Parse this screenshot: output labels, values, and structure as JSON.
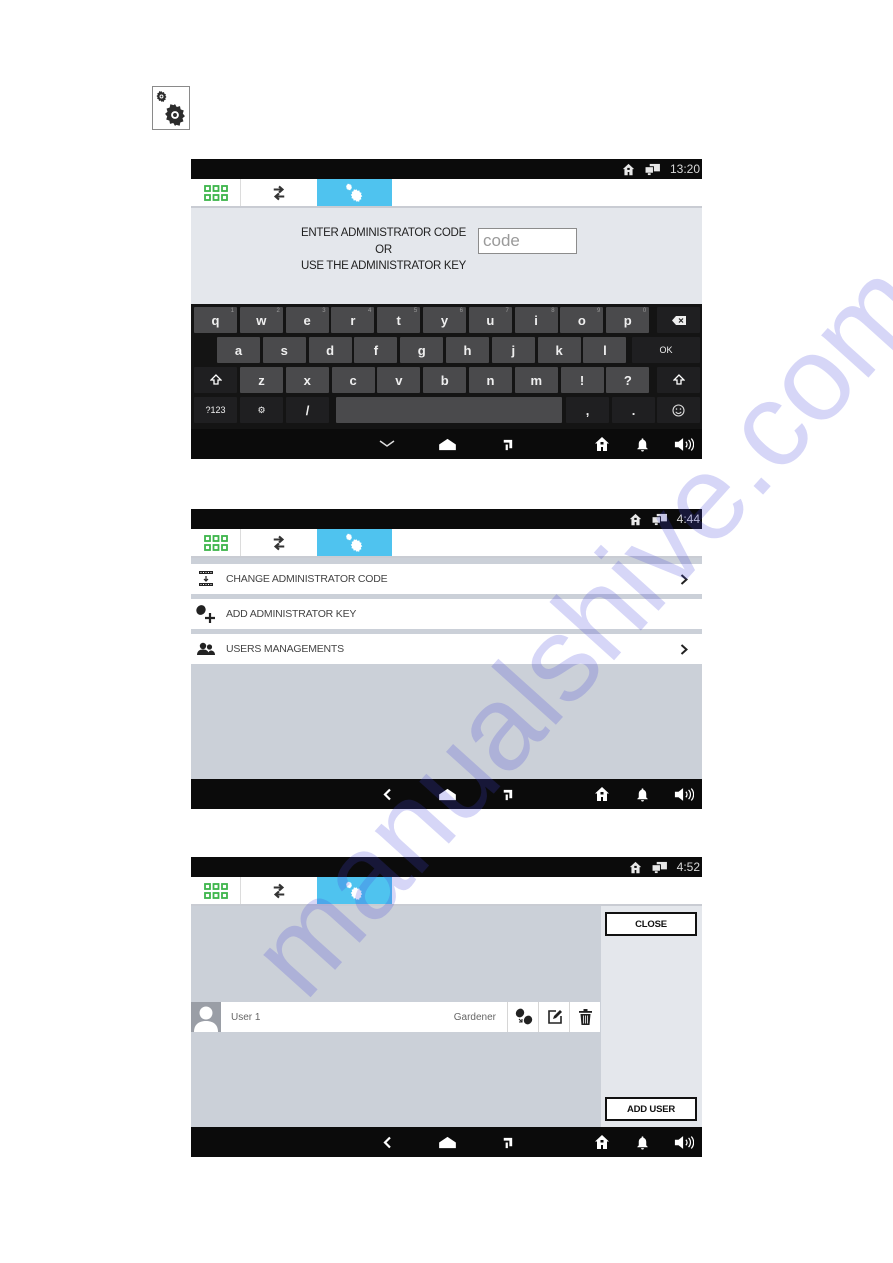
{
  "page": {
    "header_icon": "settings-gears-icon",
    "watermark": "manualshive.com"
  },
  "colors": {
    "tab_active": "#4fc3ef",
    "apps_icon": "#3cb54a",
    "status_bar": "#0b0b0b",
    "content_bg": "#cbd0d8"
  },
  "screens": [
    {
      "status": {
        "clock": "13:20",
        "icons": [
          "home-icon",
          "network-icon"
        ]
      },
      "tabs": [
        {
          "name": "apps",
          "icon": "grid-icon",
          "active": false
        },
        {
          "name": "transfer",
          "icon": "transfer-arrows-icon",
          "active": false
        },
        {
          "name": "settings",
          "icon": "settings-gears-icon",
          "active": true
        }
      ],
      "prompt": {
        "line1": "ENTER ADMINISTRATOR CODE",
        "line2": "OR",
        "line3": "USE THE ADMINISTRATOR KEY"
      },
      "code_input": {
        "placeholder": "code",
        "value": ""
      },
      "keyboard": {
        "row1": [
          {
            "k": "q",
            "h": "1"
          },
          {
            "k": "w",
            "h": "2"
          },
          {
            "k": "e",
            "h": "3"
          },
          {
            "k": "r",
            "h": "4"
          },
          {
            "k": "t",
            "h": "5"
          },
          {
            "k": "y",
            "h": "6"
          },
          {
            "k": "u",
            "h": "7"
          },
          {
            "k": "i",
            "h": "8"
          },
          {
            "k": "o",
            "h": "9"
          },
          {
            "k": "p",
            "h": "0"
          }
        ],
        "row2": [
          "a",
          "s",
          "d",
          "f",
          "g",
          "h",
          "j",
          "k",
          "l"
        ],
        "ok": "OK",
        "row3": [
          "z",
          "x",
          "c",
          "v",
          "b",
          "n",
          "m",
          "!",
          "?"
        ],
        "sym": "?123",
        "settings_key": "⚙",
        "slash": "/",
        "comma": ",",
        "period": ".",
        "emoji": "☺"
      },
      "navbar": {
        "left_icon": "hide-keyboard-icon"
      }
    },
    {
      "status": {
        "clock": "4:44",
        "icons": [
          "home-icon",
          "network-icon"
        ]
      },
      "menu": [
        {
          "label": "CHANGE ADMINISTRATOR CODE",
          "icon": "change-code-icon",
          "chevron": true
        },
        {
          "label": "ADD ADMINISTRATOR KEY",
          "icon": "add-key-icon",
          "chevron": false
        },
        {
          "label": "USERS MANAGEMENTS",
          "icon": "users-icon",
          "chevron": true
        }
      ],
      "navbar": {
        "left_icon": "back-icon"
      }
    },
    {
      "status": {
        "clock": "4:52",
        "icons": [
          "home-icon",
          "network-icon"
        ]
      },
      "close_label": "CLOSE",
      "add_user_label": "ADD USER",
      "users": [
        {
          "name": "User 1",
          "role": "Gardener"
        }
      ],
      "navbar": {
        "left_icon": "back-icon"
      }
    }
  ]
}
